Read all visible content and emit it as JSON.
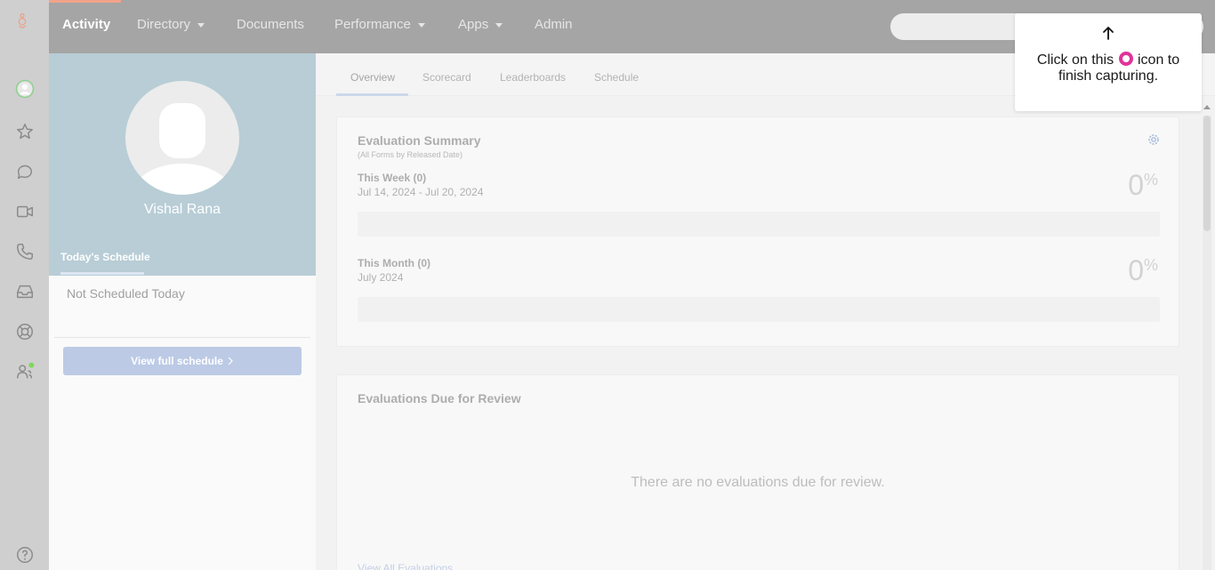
{
  "nav": {
    "items": [
      {
        "label": "Activity",
        "active": true,
        "dropdown": false
      },
      {
        "label": "Directory",
        "active": false,
        "dropdown": true
      },
      {
        "label": "Documents",
        "active": false,
        "dropdown": false
      },
      {
        "label": "Performance",
        "active": false,
        "dropdown": true
      },
      {
        "label": "Apps",
        "active": false,
        "dropdown": true
      },
      {
        "label": "Admin",
        "active": false,
        "dropdown": false
      }
    ]
  },
  "rail": {
    "icons": [
      "logo-icon",
      "user-avatar-icon",
      "star-icon",
      "chat-icon",
      "video-icon",
      "phone-icon",
      "inbox-icon",
      "support-icon",
      "people-status-icon",
      "help-icon"
    ],
    "status_color": "#7ed957"
  },
  "profile": {
    "name": "Vishal Rana",
    "schedule_tab": "Today's Schedule",
    "not_scheduled": "Not Scheduled Today",
    "view_schedule": "View full schedule"
  },
  "tabs": [
    "Overview",
    "Scorecard",
    "Leaderboards",
    "Schedule"
  ],
  "evaluation_summary": {
    "title": "Evaluation Summary",
    "subtitle": "(All Forms by Released Date)",
    "week_label": "This Week (0)",
    "week_range": "Jul 14, 2024 - Jul 20, 2024",
    "week_value": "0",
    "month_label": "This Month (0)",
    "month_range": "July 2024",
    "month_value": "0",
    "percent_sign": "%"
  },
  "evaluations_due": {
    "title": "Evaluations Due for Review",
    "empty_message": "There are no evaluations due for review.",
    "view_all": "View All Evaluations"
  },
  "tooltip": {
    "text_before": "Click on this",
    "text_after": "icon to finish capturing.",
    "ring_color": "#e0339a"
  },
  "colors": {
    "accent_bar": "#f2a389",
    "profile_bg": "#b8cdd6",
    "button_bg": "#bccae5"
  }
}
